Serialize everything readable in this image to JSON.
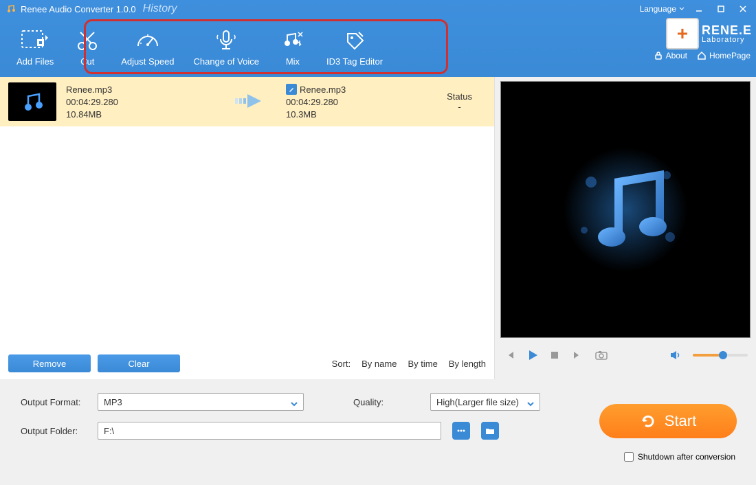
{
  "header": {
    "app_title": "Renee Audio Converter 1.0.0",
    "history": "History",
    "language": "Language",
    "brand_line1": "RENE.E",
    "brand_line2": "Laboratory",
    "link_about": "About",
    "link_homepage": "HomePage"
  },
  "toolbar": {
    "add_files": "Add Files",
    "cut": "Cut",
    "adjust_speed": "Adjust Speed",
    "change_voice": "Change of Voice",
    "mix": "Mix",
    "id3": "ID3 Tag Editor"
  },
  "file": {
    "src_name": "Renee.mp3",
    "src_duration": "00:04:29.280",
    "src_size": "10.84MB",
    "out_name": "Renee.mp3",
    "out_duration": "00:04:29.280",
    "out_size": "10.3MB",
    "status_label": "Status",
    "status_value": "-"
  },
  "actions": {
    "remove": "Remove",
    "clear": "Clear",
    "sort_label": "Sort:",
    "sort_name": "By name",
    "sort_time": "By time",
    "sort_length": "By length"
  },
  "settings": {
    "output_format_label": "Output Format:",
    "output_format_value": "MP3",
    "quality_label": "Quality:",
    "quality_value": "High(Larger file size)",
    "output_folder_label": "Output Folder:",
    "output_folder_value": "F:\\",
    "start": "Start",
    "shutdown": "Shutdown after conversion"
  }
}
